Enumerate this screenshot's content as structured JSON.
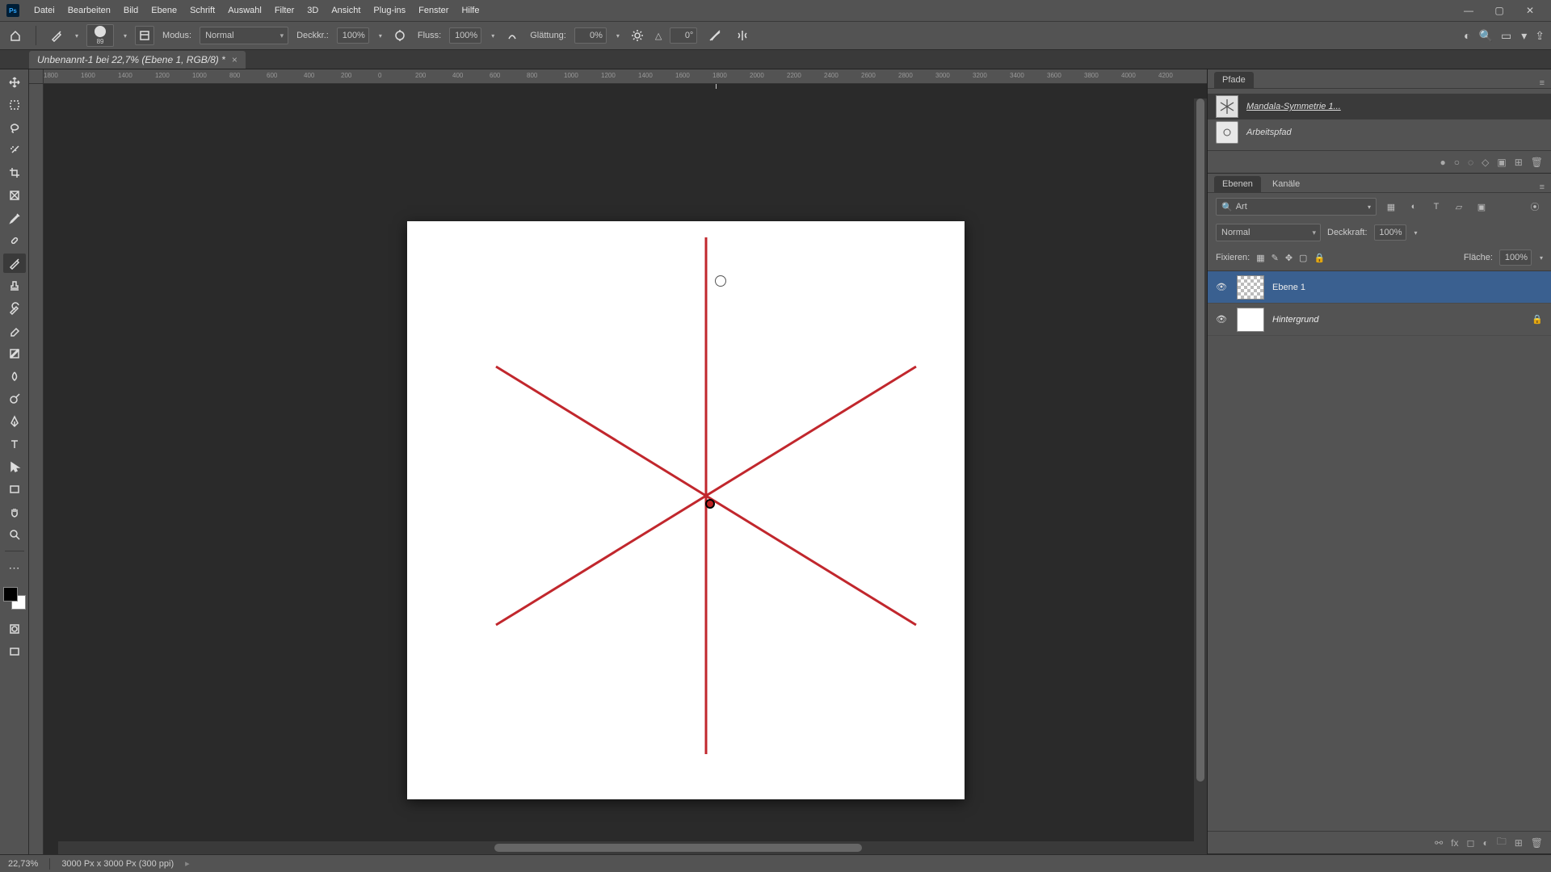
{
  "menubar": {
    "items": [
      "Datei",
      "Bearbeiten",
      "Bild",
      "Ebene",
      "Schrift",
      "Auswahl",
      "Filter",
      "3D",
      "Ansicht",
      "Plug-ins",
      "Fenster",
      "Hilfe"
    ]
  },
  "options": {
    "brush_size": "89",
    "mode_label": "Modus:",
    "mode_value": "Normal",
    "opacity_label": "Deckkr.:",
    "opacity_value": "100%",
    "flow_label": "Fluss:",
    "flow_value": "100%",
    "smoothing_label": "Glättung:",
    "smoothing_value": "0%",
    "angle_icon": "△",
    "angle_value": "0°"
  },
  "document": {
    "tab": "Unbenannt-1 bei 22,7% (Ebene 1, RGB/8) *"
  },
  "ruler_h": [
    "1800",
    "1600",
    "1400",
    "1200",
    "1000",
    "800",
    "600",
    "400",
    "200",
    "0",
    "200",
    "400",
    "600",
    "800",
    "1000",
    "1200",
    "1400",
    "1600",
    "1800",
    "2000",
    "2200",
    "2400",
    "2600",
    "2800",
    "3000",
    "3200",
    "3400",
    "3600",
    "3800",
    "4000",
    "4200"
  ],
  "paths_panel": {
    "title": "Pfade",
    "items": [
      {
        "name": "Mandala-Symmetrie 1..."
      },
      {
        "name": "Arbeitspfad"
      }
    ]
  },
  "layers_panel": {
    "tabs": [
      "Ebenen",
      "Kanäle"
    ],
    "search_placeholder": "Art",
    "blend_mode": "Normal",
    "opacity_label": "Deckkraft:",
    "opacity_value": "100%",
    "lock_label": "Fixieren:",
    "fill_label": "Fläche:",
    "fill_value": "100%",
    "layers": [
      {
        "name": "Ebene 1",
        "locked": false,
        "transparent": true
      },
      {
        "name": "Hintergrund",
        "locked": true,
        "transparent": false
      }
    ]
  },
  "statusbar": {
    "zoom": "22,73%",
    "doc_info": "3000 Px x 3000 Px (300 ppi)"
  }
}
